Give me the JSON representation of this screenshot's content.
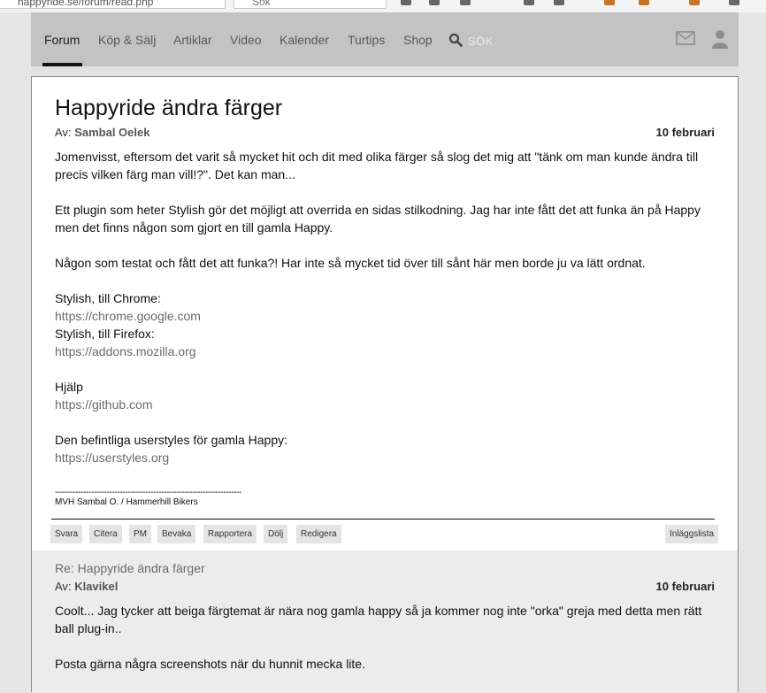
{
  "browser": {
    "url": "happyride.se/forum/read.php",
    "search_placeholder": "Sök"
  },
  "nav": {
    "items": [
      {
        "label": "Forum",
        "active": true
      },
      {
        "label": "Köp & Sälj"
      },
      {
        "label": "Artiklar"
      },
      {
        "label": "Video"
      },
      {
        "label": "Kalender"
      },
      {
        "label": "Turtips"
      },
      {
        "label": "Shop"
      }
    ],
    "search_label": "SÖK",
    "icons": [
      "search-icon",
      "mail-icon",
      "user-icon"
    ]
  },
  "post": {
    "title": "Happyride ändra färger",
    "by_prefix": "Av:",
    "author": "Sambal Oelek",
    "date": "10 februari",
    "paragraphs": {
      "p1": "Jomenvisst, eftersom det varit så mycket hit och dit med olika färger så slog det mig att \"tänk om man kunde ändra till precis vilken färg man vill!?\". Det kan man...",
      "p2": "Ett plugin som heter Stylish gör det möjligt att overrida en sidas stilkodning. Jag har inte fått det att funka än på Happy men det finns någon som gjort en till gamla Happy.",
      "p3": "Någon som testat och fått det att funka?! Har inte så mycket tid över till sånt här men borde ju va lätt ordnat.",
      "chrome_label": "Stylish, till Chrome:",
      "chrome_link": "https://chrome.google.com",
      "firefox_label": "Stylish, till Firefox:",
      "firefox_link": "https://addons.mozilla.org",
      "help_label": "Hjälp",
      "help_link": "https://github.com",
      "userstyles_label": "Den befintliga userstyles för gamla Happy:",
      "userstyles_link": "https://userstyles.org"
    },
    "signature_rule": "------------------------------------------------------------------------",
    "signature": "MVH Sambal O. / Hammerhill Bikers",
    "actions": [
      "Svara",
      "Citera",
      "PM",
      "Bevaka",
      "Rapportera",
      "Dölj",
      "Redigera"
    ],
    "list_button": "Inläggslista"
  },
  "reply": {
    "title": "Re: Happyride ändra färger",
    "by_prefix": "Av:",
    "author": "Klavikel",
    "date": "10 februari",
    "p1": "Coolt... Jag tycker att beiga färgtemat är nära nog gamla happy så ja kommer nog inte \"orka\" greja med detta men rätt ball plug-in..",
    "p2": "Posta gärna några screenshots när du hunnit mecka lite."
  }
}
